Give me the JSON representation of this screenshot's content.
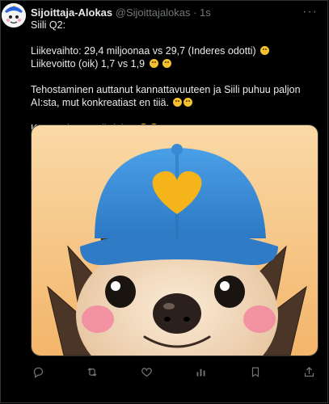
{
  "tweet": {
    "author_name": "Sijoittaja-Alokas",
    "author_handle": "@Sijoittajalokas",
    "separator": "·",
    "time": "1s",
    "more_label": "···",
    "lines": {
      "title": "Siili Q2:",
      "revenue": "Liikevaihto: 29,4 miljoonaa vs 29,7 (Inderes odotti)",
      "profit": "Liikevoitto (oik) 1,7 vs 1,9",
      "efficiency": "Tehostaminen auttanut kannattavuuteen ja Siili puhuu paljon AI:sta, mut konkreatiast en tiiä.",
      "question": "Kääntyyks tää vihdoin?"
    }
  },
  "image": {
    "subject": "hedgehog wearing blue cap with yellow heart",
    "colors": {
      "background": "#f5c98a",
      "cap": "#3b8fd6",
      "heart": "#f4b41a",
      "fur": "#4a3526",
      "face": "#f2dcc2",
      "cheeks": "#f28ba0"
    }
  },
  "actions": {
    "reply_icon": "reply-icon",
    "retweet_icon": "retweet-icon",
    "like_icon": "like-icon",
    "views_icon": "views-icon",
    "bookmark_icon": "bookmark-icon",
    "share_icon": "share-icon"
  }
}
